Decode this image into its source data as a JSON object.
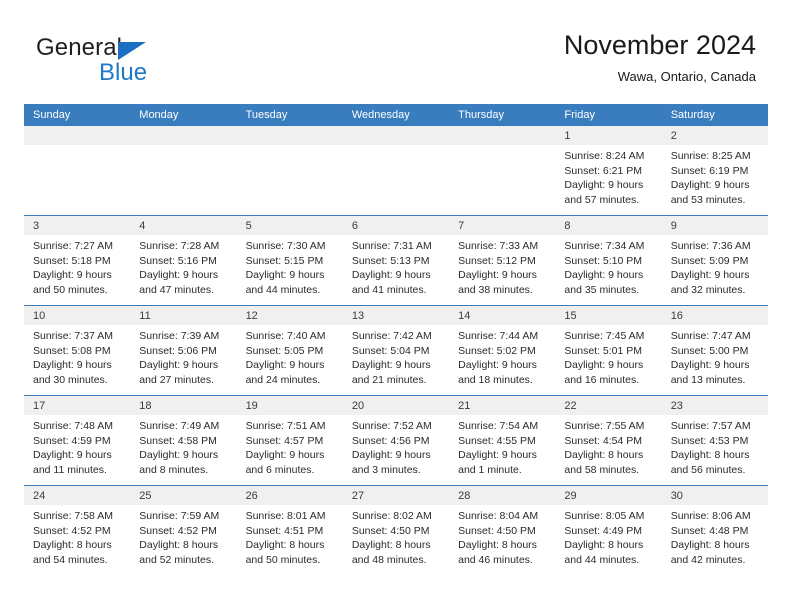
{
  "logo": {
    "word_dark": "General",
    "word_blue": "Blue",
    "triangle_color": "#1b6ec2",
    "blue_color": "#1e7ac8"
  },
  "header": {
    "title": "November 2024",
    "subtitle": "Wawa, Ontario, Canada"
  },
  "theme": {
    "header_band": "#3a7dbf",
    "daynum_band": "#f0f0f0",
    "text": "#2b2b2b"
  },
  "calendar": {
    "weekdays": [
      "Sunday",
      "Monday",
      "Tuesday",
      "Wednesday",
      "Thursday",
      "Friday",
      "Saturday"
    ],
    "labels": {
      "sunrise": "Sunrise:",
      "sunset": "Sunset:",
      "daylight": "Daylight:"
    },
    "weeks": [
      [
        {
          "day": "",
          "empty": true
        },
        {
          "day": "",
          "empty": true
        },
        {
          "day": "",
          "empty": true
        },
        {
          "day": "",
          "empty": true
        },
        {
          "day": "",
          "empty": true
        },
        {
          "day": "1",
          "sunrise": "Sunrise: 8:24 AM",
          "sunset": "Sunset: 6:21 PM",
          "daylight_1": "Daylight: 9 hours",
          "daylight_2": "and 57 minutes."
        },
        {
          "day": "2",
          "sunrise": "Sunrise: 8:25 AM",
          "sunset": "Sunset: 6:19 PM",
          "daylight_1": "Daylight: 9 hours",
          "daylight_2": "and 53 minutes."
        }
      ],
      [
        {
          "day": "3",
          "sunrise": "Sunrise: 7:27 AM",
          "sunset": "Sunset: 5:18 PM",
          "daylight_1": "Daylight: 9 hours",
          "daylight_2": "and 50 minutes."
        },
        {
          "day": "4",
          "sunrise": "Sunrise: 7:28 AM",
          "sunset": "Sunset: 5:16 PM",
          "daylight_1": "Daylight: 9 hours",
          "daylight_2": "and 47 minutes."
        },
        {
          "day": "5",
          "sunrise": "Sunrise: 7:30 AM",
          "sunset": "Sunset: 5:15 PM",
          "daylight_1": "Daylight: 9 hours",
          "daylight_2": "and 44 minutes."
        },
        {
          "day": "6",
          "sunrise": "Sunrise: 7:31 AM",
          "sunset": "Sunset: 5:13 PM",
          "daylight_1": "Daylight: 9 hours",
          "daylight_2": "and 41 minutes."
        },
        {
          "day": "7",
          "sunrise": "Sunrise: 7:33 AM",
          "sunset": "Sunset: 5:12 PM",
          "daylight_1": "Daylight: 9 hours",
          "daylight_2": "and 38 minutes."
        },
        {
          "day": "8",
          "sunrise": "Sunrise: 7:34 AM",
          "sunset": "Sunset: 5:10 PM",
          "daylight_1": "Daylight: 9 hours",
          "daylight_2": "and 35 minutes."
        },
        {
          "day": "9",
          "sunrise": "Sunrise: 7:36 AM",
          "sunset": "Sunset: 5:09 PM",
          "daylight_1": "Daylight: 9 hours",
          "daylight_2": "and 32 minutes."
        }
      ],
      [
        {
          "day": "10",
          "sunrise": "Sunrise: 7:37 AM",
          "sunset": "Sunset: 5:08 PM",
          "daylight_1": "Daylight: 9 hours",
          "daylight_2": "and 30 minutes."
        },
        {
          "day": "11",
          "sunrise": "Sunrise: 7:39 AM",
          "sunset": "Sunset: 5:06 PM",
          "daylight_1": "Daylight: 9 hours",
          "daylight_2": "and 27 minutes."
        },
        {
          "day": "12",
          "sunrise": "Sunrise: 7:40 AM",
          "sunset": "Sunset: 5:05 PM",
          "daylight_1": "Daylight: 9 hours",
          "daylight_2": "and 24 minutes."
        },
        {
          "day": "13",
          "sunrise": "Sunrise: 7:42 AM",
          "sunset": "Sunset: 5:04 PM",
          "daylight_1": "Daylight: 9 hours",
          "daylight_2": "and 21 minutes."
        },
        {
          "day": "14",
          "sunrise": "Sunrise: 7:44 AM",
          "sunset": "Sunset: 5:02 PM",
          "daylight_1": "Daylight: 9 hours",
          "daylight_2": "and 18 minutes."
        },
        {
          "day": "15",
          "sunrise": "Sunrise: 7:45 AM",
          "sunset": "Sunset: 5:01 PM",
          "daylight_1": "Daylight: 9 hours",
          "daylight_2": "and 16 minutes."
        },
        {
          "day": "16",
          "sunrise": "Sunrise: 7:47 AM",
          "sunset": "Sunset: 5:00 PM",
          "daylight_1": "Daylight: 9 hours",
          "daylight_2": "and 13 minutes."
        }
      ],
      [
        {
          "day": "17",
          "sunrise": "Sunrise: 7:48 AM",
          "sunset": "Sunset: 4:59 PM",
          "daylight_1": "Daylight: 9 hours",
          "daylight_2": "and 11 minutes."
        },
        {
          "day": "18",
          "sunrise": "Sunrise: 7:49 AM",
          "sunset": "Sunset: 4:58 PM",
          "daylight_1": "Daylight: 9 hours",
          "daylight_2": "and 8 minutes."
        },
        {
          "day": "19",
          "sunrise": "Sunrise: 7:51 AM",
          "sunset": "Sunset: 4:57 PM",
          "daylight_1": "Daylight: 9 hours",
          "daylight_2": "and 6 minutes."
        },
        {
          "day": "20",
          "sunrise": "Sunrise: 7:52 AM",
          "sunset": "Sunset: 4:56 PM",
          "daylight_1": "Daylight: 9 hours",
          "daylight_2": "and 3 minutes."
        },
        {
          "day": "21",
          "sunrise": "Sunrise: 7:54 AM",
          "sunset": "Sunset: 4:55 PM",
          "daylight_1": "Daylight: 9 hours",
          "daylight_2": "and 1 minute."
        },
        {
          "day": "22",
          "sunrise": "Sunrise: 7:55 AM",
          "sunset": "Sunset: 4:54 PM",
          "daylight_1": "Daylight: 8 hours",
          "daylight_2": "and 58 minutes."
        },
        {
          "day": "23",
          "sunrise": "Sunrise: 7:57 AM",
          "sunset": "Sunset: 4:53 PM",
          "daylight_1": "Daylight: 8 hours",
          "daylight_2": "and 56 minutes."
        }
      ],
      [
        {
          "day": "24",
          "sunrise": "Sunrise: 7:58 AM",
          "sunset": "Sunset: 4:52 PM",
          "daylight_1": "Daylight: 8 hours",
          "daylight_2": "and 54 minutes."
        },
        {
          "day": "25",
          "sunrise": "Sunrise: 7:59 AM",
          "sunset": "Sunset: 4:52 PM",
          "daylight_1": "Daylight: 8 hours",
          "daylight_2": "and 52 minutes."
        },
        {
          "day": "26",
          "sunrise": "Sunrise: 8:01 AM",
          "sunset": "Sunset: 4:51 PM",
          "daylight_1": "Daylight: 8 hours",
          "daylight_2": "and 50 minutes."
        },
        {
          "day": "27",
          "sunrise": "Sunrise: 8:02 AM",
          "sunset": "Sunset: 4:50 PM",
          "daylight_1": "Daylight: 8 hours",
          "daylight_2": "and 48 minutes."
        },
        {
          "day": "28",
          "sunrise": "Sunrise: 8:04 AM",
          "sunset": "Sunset: 4:50 PM",
          "daylight_1": "Daylight: 8 hours",
          "daylight_2": "and 46 minutes."
        },
        {
          "day": "29",
          "sunrise": "Sunrise: 8:05 AM",
          "sunset": "Sunset: 4:49 PM",
          "daylight_1": "Daylight: 8 hours",
          "daylight_2": "and 44 minutes."
        },
        {
          "day": "30",
          "sunrise": "Sunrise: 8:06 AM",
          "sunset": "Sunset: 4:48 PM",
          "daylight_1": "Daylight: 8 hours",
          "daylight_2": "and 42 minutes."
        }
      ]
    ]
  }
}
